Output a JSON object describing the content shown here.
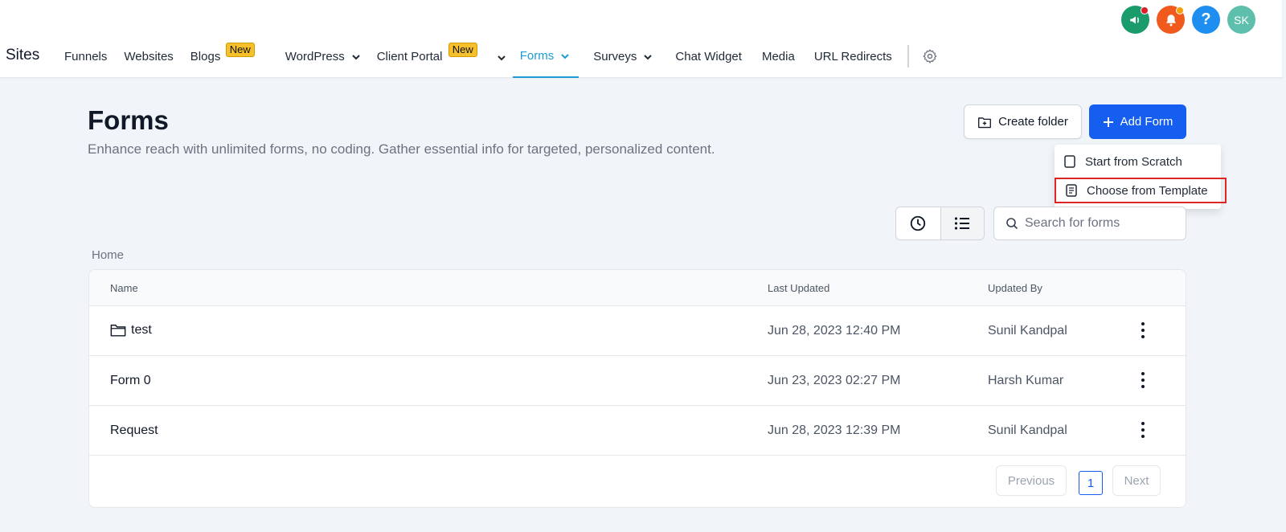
{
  "header": {
    "site_title": "Sites",
    "avatar_initials": "SK",
    "help_glyph": "?"
  },
  "nav": {
    "funnels": "Funnels",
    "websites": "Websites",
    "blogs": "Blogs",
    "blogs_badge": "New",
    "wordpress": "WordPress",
    "client_portal": "Client Portal",
    "client_portal_badge": "New",
    "forms": "Forms",
    "surveys": "Surveys",
    "chat_widget": "Chat Widget",
    "media": "Media",
    "url_redirects": "URL Redirects"
  },
  "page": {
    "title": "Forms",
    "description": "Enhance reach with unlimited forms, no coding. Gather essential info for targeted, personalized content.",
    "create_folder_label": "Create folder",
    "add_form_label": "Add Form"
  },
  "dropdown": {
    "start_from_scratch": "Start from Scratch",
    "choose_from_template": "Choose from Template"
  },
  "toolbar": {
    "search_placeholder": "Search for forms"
  },
  "breadcrumb": {
    "home": "Home"
  },
  "table": {
    "headers": {
      "name": "Name",
      "last_updated": "Last Updated",
      "updated_by": "Updated By"
    },
    "rows": [
      {
        "name": "test",
        "is_folder": true,
        "last_updated": "Jun 28, 2023 12:40 PM",
        "updated_by": "Sunil Kandpal"
      },
      {
        "name": "Form 0",
        "is_folder": false,
        "last_updated": "Jun 23, 2023 02:27 PM",
        "updated_by": "Harsh Kumar"
      },
      {
        "name": "Request",
        "is_folder": false,
        "last_updated": "Jun 28, 2023 12:39 PM",
        "updated_by": "Sunil Kandpal"
      }
    ]
  },
  "pagination": {
    "previous": "Previous",
    "current_page": "1",
    "next": "Next"
  },
  "colors": {
    "accent": "#155eef",
    "active_tab": "#1d9bd6",
    "badge": "#f6c02b",
    "highlight_border": "#dc2626"
  },
  "icons": {
    "announcement": "megaphone-icon",
    "notifications": "bell-icon",
    "help": "help-icon",
    "settings": "gear-icon",
    "create_folder": "folder-plus-icon",
    "add": "plus-icon",
    "scratch": "blank-page-icon",
    "template": "template-document-icon",
    "recent": "clock-icon",
    "list": "list-view-icon",
    "search": "search-icon",
    "folder": "folder-icon",
    "more": "kebab-menu-icon"
  }
}
